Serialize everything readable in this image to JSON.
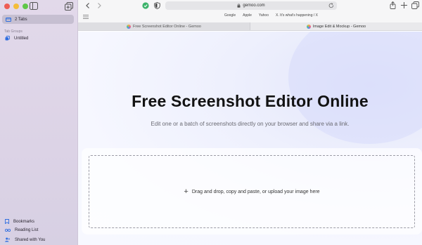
{
  "sidebar": {
    "tabs_label": "2 Tabs",
    "section_label": "Tab Groups",
    "group_item": "Untitled",
    "bottom_items": [
      "Bookmarks",
      "Reading List",
      "Shared with You"
    ]
  },
  "toolbar": {
    "url": "gemoo.com",
    "favorites": [
      "Google",
      "Apple",
      "Yahoo",
      "X. It's what's happening / X"
    ]
  },
  "tabs": [
    {
      "title": "Free Screenshot Editor Online - Gemoo",
      "active": false
    },
    {
      "title": "Image Edit & Mockup - Gemoo",
      "active": true
    }
  ],
  "page": {
    "headline": "Free Screenshot Editor Online",
    "subtitle": "Edit one or a batch of screenshots directly on your browser and share via a link.",
    "dropzone_text": "Drag and drop, copy and paste, or upload your image here",
    "dropzone_icon": "+"
  },
  "colors": {
    "close": "#ee5d55",
    "minimize": "#f4bd3a",
    "zoom": "#5fc748",
    "sidebar_icon": "#2f6ee0"
  }
}
